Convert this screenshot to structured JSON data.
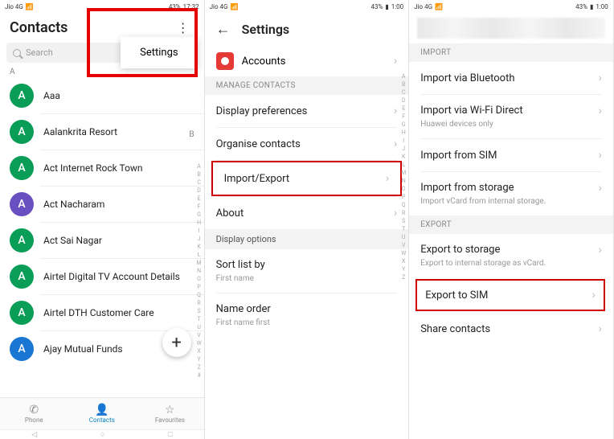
{
  "statusbar": {
    "carrier": "Jio 4G",
    "signal_text": "ᯤ ⁴ᴳ",
    "battery_pct": "43%",
    "time": "1:00",
    "time1": "17:32"
  },
  "phone1": {
    "title": "Contacts",
    "search_placeholder": "Search",
    "settings_label": "Settings",
    "section_letter": "A",
    "index_b": "B",
    "contacts": [
      {
        "initial": "A",
        "name": "Aaa",
        "cls": ""
      },
      {
        "initial": "A",
        "name": "Aalankrita Resort",
        "cls": ""
      },
      {
        "initial": "A",
        "name": "Act Internet Rock Town",
        "cls": ""
      },
      {
        "initial": "A",
        "name": "Act Nacharam",
        "cls": "purple"
      },
      {
        "initial": "A",
        "name": "Act Sai Nagar",
        "cls": ""
      },
      {
        "initial": "A",
        "name": "Airtel Digital TV Account Details",
        "cls": ""
      },
      {
        "initial": "A",
        "name": "Airtel DTH Customer Care",
        "cls": ""
      },
      {
        "initial": "A",
        "name": "Ajay Mutual Funds",
        "cls": "blue"
      }
    ],
    "fab": "+",
    "nav": {
      "phone": "Phone",
      "contacts": "Contacts",
      "fav": "Favourites"
    },
    "alphabet": "A B C D E F G H I J K L M N O P Q R S T U V W X Y Z #"
  },
  "phone2": {
    "title": "Settings",
    "accounts": "Accounts",
    "manage_header": "MANAGE CONTACTS",
    "rows": {
      "display_prefs": "Display preferences",
      "organise": "Organise contacts",
      "import_export": "Import/Export",
      "about": "About"
    },
    "display_options": "Display options",
    "sort_by": "Sort list by",
    "sort_by_sub": "First name",
    "name_order": "Name order",
    "name_order_sub": "First name first",
    "alphabet": "A B C D E F G H I J K L M N O P Q R S T U V W X Y Z"
  },
  "phone3": {
    "import_header": "IMPORT",
    "import_bt": "Import via Bluetooth",
    "import_wifi": "Import via Wi-Fi Direct",
    "import_wifi_sub": "Huawei devices only",
    "import_sim": "Import from SIM",
    "import_storage": "Import from storage",
    "import_storage_sub": "Import vCard from internal storage.",
    "export_header": "EXPORT",
    "export_storage": "Export to storage",
    "export_storage_sub": "Export to internal storage as vCard.",
    "export_sim": "Export to SIM",
    "share": "Share contacts"
  }
}
